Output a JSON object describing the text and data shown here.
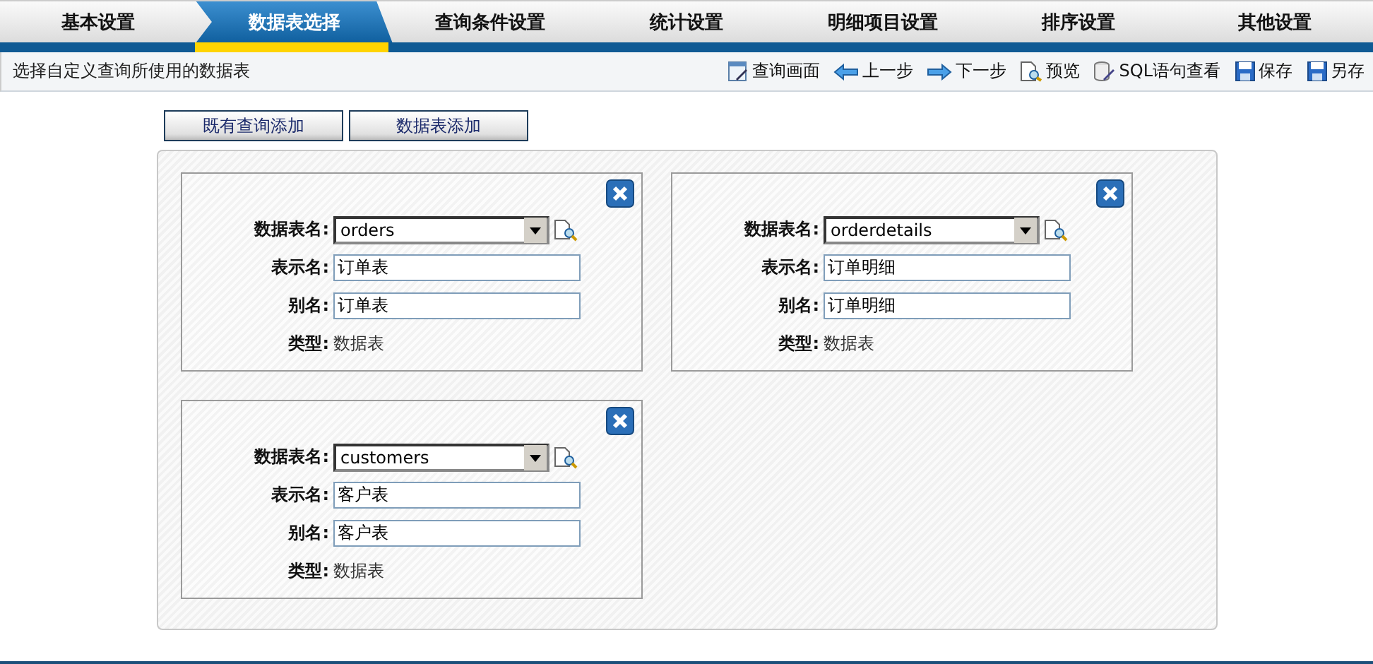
{
  "tabs": [
    {
      "label": "基本设置",
      "selected": false
    },
    {
      "label": "数据表选择",
      "selected": true
    },
    {
      "label": "查询条件设置",
      "selected": false
    },
    {
      "label": "统计设置",
      "selected": false
    },
    {
      "label": "明细项目设置",
      "selected": false
    },
    {
      "label": "排序设置",
      "selected": false
    },
    {
      "label": "其他设置",
      "selected": false
    }
  ],
  "description": "选择自定义查询所使用的数据表",
  "toolbar": [
    {
      "kind": "screen",
      "label": "查询画面"
    },
    {
      "kind": "back",
      "label": "上一步"
    },
    {
      "kind": "next",
      "label": "下一步"
    },
    {
      "kind": "preview",
      "label": "预览"
    },
    {
      "kind": "sql",
      "label": "SQL语句查看"
    },
    {
      "kind": "save",
      "label": "保存"
    },
    {
      "kind": "save",
      "label": "另存"
    }
  ],
  "buttons": [
    "既有查询添加",
    "数据表添加"
  ],
  "cards": [
    {
      "fields": [
        {
          "kind": "select",
          "label": "数据表名:",
          "value": "orders"
        },
        {
          "kind": "input",
          "label": "表示名:",
          "value": "订单表"
        },
        {
          "kind": "input",
          "label": "别名:",
          "value": "订单表"
        },
        {
          "kind": "text",
          "label": "类型:",
          "value": "数据表"
        }
      ]
    },
    {
      "fields": [
        {
          "kind": "select",
          "label": "数据表名:",
          "value": "orderdetails"
        },
        {
          "kind": "input",
          "label": "表示名:",
          "value": "订单明细"
        },
        {
          "kind": "input",
          "label": "别名:",
          "value": "订单明细"
        },
        {
          "kind": "text",
          "label": "类型:",
          "value": "数据表"
        }
      ]
    },
    {
      "fields": [
        {
          "kind": "select",
          "label": "数据表名:",
          "value": "customers"
        },
        {
          "kind": "input",
          "label": "表示名:",
          "value": "客户表"
        },
        {
          "kind": "input",
          "label": "别名:",
          "value": "客户表"
        },
        {
          "kind": "text",
          "label": "类型:",
          "value": "数据表"
        }
      ]
    }
  ]
}
